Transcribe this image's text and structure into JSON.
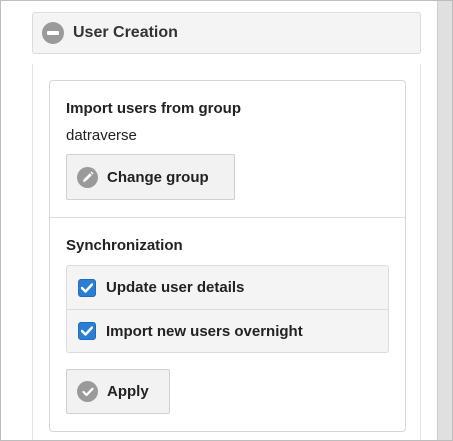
{
  "section": {
    "title": "User Creation",
    "collapse_icon": "minus-circle-icon"
  },
  "import_group": {
    "heading": "Import users from group",
    "group_name": "datraverse",
    "change_button_label": "Change group",
    "change_button_icon": "pencil-icon"
  },
  "synchronization": {
    "heading": "Synchronization",
    "options": [
      {
        "label": "Update user details",
        "checked": true
      },
      {
        "label": "Import new users overnight",
        "checked": true
      }
    ],
    "apply_button_label": "Apply",
    "apply_button_icon": "checkmark-circle-icon"
  },
  "colors": {
    "checkbox_accent": "#2a7fd4",
    "icon_gray": "#9a9a9a"
  }
}
